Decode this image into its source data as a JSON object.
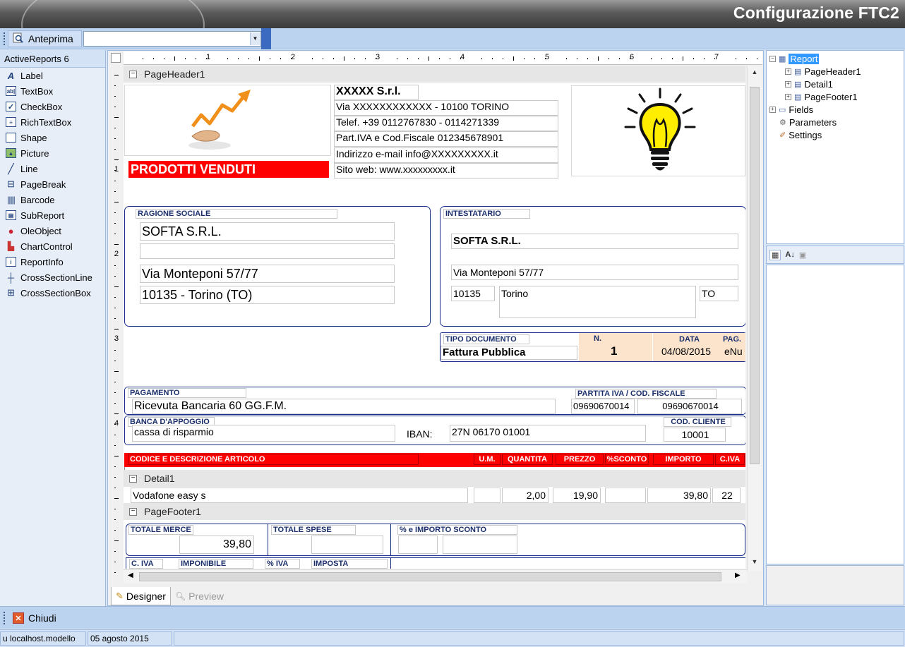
{
  "app": {
    "title": "Configurazione FTC2"
  },
  "toolbar": {
    "preview_label": "Anteprima",
    "combo_value": ""
  },
  "toolbox": {
    "header": "ActiveReports 6",
    "items": [
      {
        "label": "Label",
        "icon": "label-icon"
      },
      {
        "label": "TextBox",
        "icon": "textbox-icon"
      },
      {
        "label": "CheckBox",
        "icon": "checkbox-icon"
      },
      {
        "label": "RichTextBox",
        "icon": "richtextbox-icon"
      },
      {
        "label": "Shape",
        "icon": "shape-icon"
      },
      {
        "label": "Picture",
        "icon": "picture-icon"
      },
      {
        "label": "Line",
        "icon": "line-icon"
      },
      {
        "label": "PageBreak",
        "icon": "pagebreak-icon"
      },
      {
        "label": "Barcode",
        "icon": "barcode-icon"
      },
      {
        "label": "SubReport",
        "icon": "subreport-icon"
      },
      {
        "label": "OleObject",
        "icon": "oleobject-icon"
      },
      {
        "label": "ChartControl",
        "icon": "chart-icon"
      },
      {
        "label": "ReportInfo",
        "icon": "reportinfo-icon"
      },
      {
        "label": "CrossSectionLine",
        "icon": "crosssectionline-icon"
      },
      {
        "label": "CrossSectionBox",
        "icon": "crosssectionbox-icon"
      }
    ]
  },
  "ruler": {
    "top": [
      "1",
      "2",
      "3",
      "4",
      "5",
      "6",
      "7"
    ],
    "left": [
      "1",
      "2",
      "3",
      "4"
    ]
  },
  "bands": {
    "header": "PageHeader1",
    "detail": "Detail1",
    "footer": "PageFooter1"
  },
  "company": {
    "name": "XXXXX S.r.l.",
    "address": "Via XXXXXXXXXXXX - 10100 TORINO",
    "phone": "Telef. +39 0112767830 - 0114271339",
    "vat": "Part.IVA e Cod.Fiscale 012345678901",
    "email": "Indirizzo e-mail   info@XXXXXXXXX.it",
    "web": "Sito web: www.xxxxxxxxx.it"
  },
  "report_title": "PRODOTTI VENDUTI",
  "ragione": {
    "label": "RAGIONE SOCIALE",
    "name": "SOFTA S.R.L.",
    "line2": "",
    "street": "Via Monteponi 57/77",
    "city": "10135 - Torino (TO)"
  },
  "intestatario": {
    "label": "INTESTATARIO",
    "name": "SOFTA S.R.L.",
    "street": "Via Monteponi 57/77",
    "cap": "10135",
    "city": "Torino",
    "prov": "TO"
  },
  "documento": {
    "tipo_label": "TIPO DOCUMENTO",
    "tipo": "Fattura Pubblica",
    "n_label": "N.",
    "n": "1",
    "data_label": "DATA",
    "data": "04/08/2015",
    "pag_label": "PAG.",
    "pag": "eNu"
  },
  "pagamento": {
    "label": "PAGAMENTO",
    "value": "Ricevuta Bancaria 60 GG.F.M.",
    "piva_label": "PARTITA IVA / COD. FISCALE",
    "piva": "09690670014",
    "cf": "09690670014"
  },
  "banca": {
    "label": "BANCA D'APPOGGIO",
    "value": "cassa di risparmio",
    "iban_label": "IBAN:",
    "iban": "27N 06170 01001",
    "cliente_label": "COD. CLIENTE",
    "cliente": "10001"
  },
  "columns": {
    "descr": "CODICE E DESCRIZIONE ARTICOLO",
    "um": "U.M.",
    "qty": "QUANTITA",
    "price": "PREZZO",
    "disc": "%SCONTO",
    "amount": "IMPORTO",
    "iva": "C.IVA"
  },
  "detail_row": {
    "descr": "Vodafone easy s",
    "um": "",
    "qty": "2,00",
    "price": "19,90",
    "disc": "",
    "amount": "39,80",
    "iva": "22"
  },
  "footer": {
    "merce_label": "TOTALE MERCE",
    "merce": "39,80",
    "spese_label": "TOTALE SPESE",
    "sconto_label": "% e IMPORTO SCONTO",
    "civa_label": "C. IVA",
    "imponibile_label": "IMPONIBILE",
    "piva_label": "% IVA",
    "imposta_label": "IMPOSTA"
  },
  "tabs": {
    "designer": "Designer",
    "preview": "Preview"
  },
  "tree": {
    "root": "Report",
    "header": "PageHeader1",
    "detail": "Detail1",
    "footer": "PageFooter1",
    "fields": "Fields",
    "parameters": "Parameters",
    "settings": "Settings"
  },
  "bottom": {
    "close_label": "Chiudi"
  },
  "status": {
    "db": "u localhost.modello",
    "date": "05 agosto 2015"
  },
  "colors": {
    "accent_red": "#ff0000",
    "frame_blue": "#1a2f8a",
    "doc_peach": "#fbe3cc"
  }
}
